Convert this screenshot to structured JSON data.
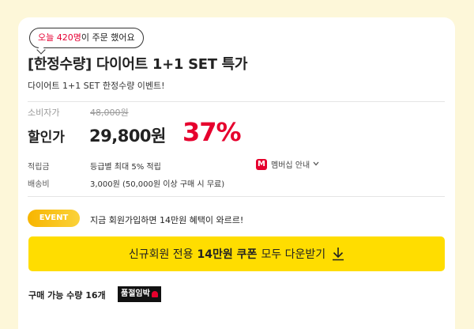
{
  "bubble": {
    "highlight": "오늘 420명",
    "rest": "이 주문 했어요"
  },
  "product": {
    "title": "[한정수량] 다이어트 1+1 SET 특가",
    "subtitle": "다이어트 1+1 SET 한정수량 이벤트!"
  },
  "price": {
    "consumer_label": "소비자가",
    "consumer_price": "48,000원",
    "discount_label": "할인가",
    "sale_price": "29,800원",
    "discount_rate": "37%"
  },
  "points": {
    "label": "적립금",
    "value": "등급별 최대 5% 적립"
  },
  "membership": {
    "badge": "M",
    "label": "멤버십 안내",
    "icon": "chevron-down-icon"
  },
  "shipping": {
    "label": "배송비",
    "value": "3,000원 (50,000원 이상 구매 시 무료)"
  },
  "event": {
    "badge": "EVENT",
    "text": "지금 회원가입하면 14만원 혜택이 와르르!"
  },
  "coupon": {
    "prefix": "신규회원 전용",
    "strong": "14만원 쿠폰",
    "suffix": "모두 다운받기",
    "icon": "download-icon"
  },
  "stock": {
    "text": "구매 가능 수량 16개",
    "badge": "품절임박",
    "icon": "siren-icon"
  },
  "colors": {
    "accent_red": "#e6002d",
    "coupon_yellow": "#ffdd00",
    "event_orange": "#f7b500",
    "background": "#fdf7d9"
  }
}
